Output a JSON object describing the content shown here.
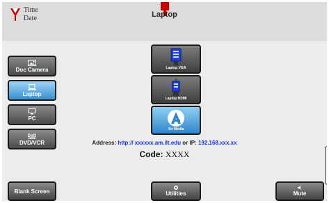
{
  "header": {
    "time_label": "Time",
    "date_label": "Date",
    "title": "Laptop"
  },
  "sidebar": {
    "items": [
      {
        "label": "Doc Camera",
        "icon": "image-icon",
        "active": false
      },
      {
        "label": "Laptop",
        "icon": "laptop-icon",
        "active": true
      },
      {
        "label": "PC",
        "icon": "monitor-icon",
        "active": false
      },
      {
        "label": "DVD/VCR",
        "icon": "dvd-icon",
        "active": false
      }
    ]
  },
  "sources": [
    {
      "label": "Laptop VGA",
      "icon": "vga-connector-icon",
      "active": false
    },
    {
      "label": "Laptop HDMI",
      "icon": "hdmi-connector-icon",
      "active": false
    },
    {
      "label": "Air Media",
      "icon": "air-media-icon",
      "active": true
    }
  ],
  "info": {
    "address_prefix": "Address:",
    "address_url": "http:// xxxxxx.am.ilt.edu",
    "or_ip_label": "or IP:",
    "ip_value": "192.168.xxx.xx",
    "code_label": "Code:",
    "code_value": "XXXX"
  },
  "footer": {
    "blank_screen_label": "Blank Screen",
    "utilities_label": "Utilities",
    "mute_label": "Mute"
  },
  "colors": {
    "accent_active": "#3b8fd0",
    "link_blue": "#1a33d6",
    "brand_red": "#cc0000"
  }
}
